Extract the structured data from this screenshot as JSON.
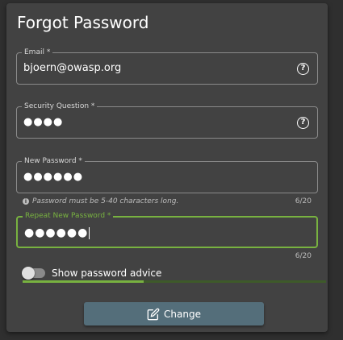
{
  "title": "Forgot Password",
  "email": {
    "label": "Email *",
    "value": "bjoern@owasp.org",
    "icon": "help-circle-icon"
  },
  "security_question": {
    "label": "Security Question *",
    "value": "●●●●",
    "icon": "help-circle-icon"
  },
  "new_password": {
    "label": "New Password *",
    "value": "●●●●●●",
    "hint": "Password must be 5-40 characters long.",
    "counter": "6/20"
  },
  "repeat_password": {
    "label": "Repeat New Password *",
    "value": "●●●●●●",
    "counter": "6/20"
  },
  "advice_toggle": {
    "label": "Show password advice",
    "checked": false
  },
  "strength": {
    "fraction": 0.4
  },
  "change_button": {
    "label": "Change",
    "icon": "edit-icon"
  },
  "colors": {
    "accent": "#78b240",
    "button": "#546e7a",
    "card": "#424242"
  }
}
